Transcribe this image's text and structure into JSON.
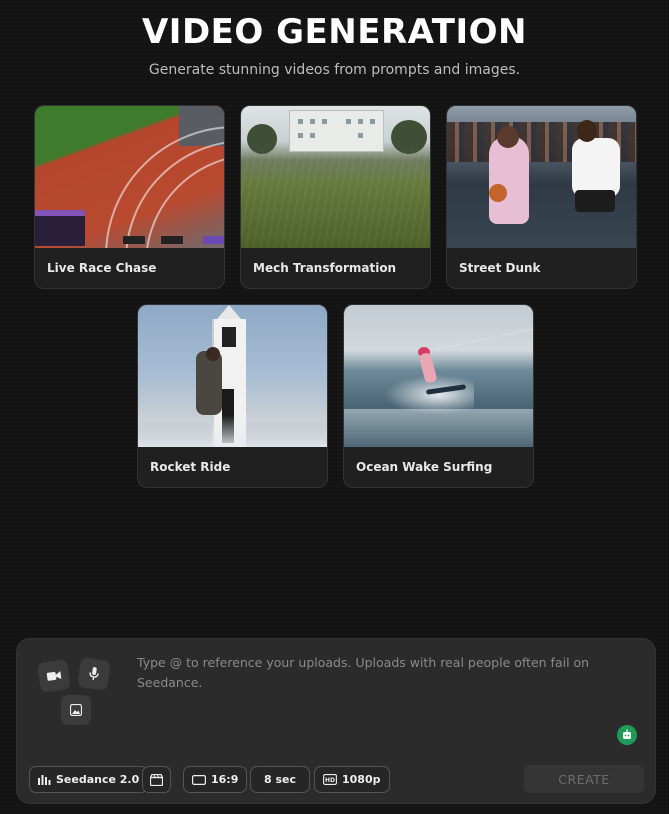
{
  "header": {
    "title": "VIDEO GENERATION",
    "subtitle": "Generate stunning videos from prompts and images."
  },
  "gallery": [
    {
      "label": "Live Race Chase",
      "thumb": "race-track-thumbnail"
    },
    {
      "label": "Mech Transformation",
      "thumb": "field-motion-thumbnail"
    },
    {
      "label": "Street Dunk",
      "thumb": "street-basketball-thumbnail"
    },
    {
      "label": "Rocket Ride",
      "thumb": "rocket-climb-thumbnail"
    },
    {
      "label": "Ocean Wake Surfing",
      "thumb": "wake-surf-thumbnail"
    }
  ],
  "composer": {
    "placeholder": "Type @ to reference your uploads. Uploads with real people often fail on Seedance.",
    "upload_icons": [
      "video-upload-icon",
      "audio-upload-icon",
      "image-upload-icon"
    ],
    "assistant_icon": "robot-icon",
    "model_label": "Seedance 2.0",
    "aspect_label": "16:9",
    "duration_label": "8 sec",
    "resolution_label": "1080p",
    "create_label": "CREATE"
  },
  "colors": {
    "background": "#131313",
    "card": "#202020",
    "composer": "#2b2b2b",
    "accent_green": "#1f9b57"
  }
}
